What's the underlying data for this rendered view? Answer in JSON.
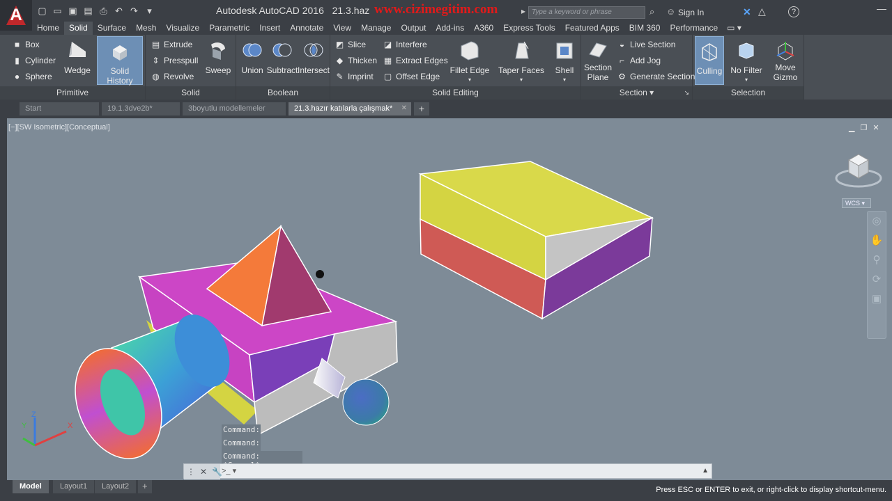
{
  "titlebar": {
    "title": "Autodesk AutoCAD 2016",
    "doc_prefix": "21.3.haz",
    "watermark": "www.cizimegitim.com",
    "search_placeholder": "Type a keyword or phrase",
    "signin": "Sign In",
    "help": "?"
  },
  "qat_icons": [
    "new-file-icon",
    "open-folder-icon",
    "save-icon",
    "save-as-icon",
    "print-icon",
    "undo-icon",
    "redo-icon",
    "dropdown-icon"
  ],
  "ribbon_tabs": [
    "Home",
    "Solid",
    "Surface",
    "Mesh",
    "Visualize",
    "Parametric",
    "Insert",
    "Annotate",
    "View",
    "Manage",
    "Output",
    "Add-ins",
    "A360",
    "Express Tools",
    "Featured Apps",
    "BIM 360",
    "Performance"
  ],
  "active_tab": "Solid",
  "panels": {
    "primitive": {
      "title": "Primitive",
      "small": [
        "Box",
        "Cylinder",
        "Sphere"
      ],
      "wedge": "Wedge",
      "solid_history": "Solid History"
    },
    "solid": {
      "title": "Solid",
      "small": [
        "Extrude",
        "Presspull",
        "Revolve"
      ],
      "sweep": "Sweep"
    },
    "boolean": {
      "title": "Boolean",
      "union": "Union",
      "subtract": "Subtract",
      "intersect": "Intersect"
    },
    "solid_editing": {
      "title": "Solid Editing",
      "col1": [
        "Slice",
        "Thicken",
        "Imprint"
      ],
      "col2": [
        "Interfere",
        "Extract Edges",
        "Offset Edge"
      ],
      "fillet": "Fillet Edge",
      "taper": "Taper Faces",
      "shell": "Shell"
    },
    "section": {
      "title": "Section",
      "plane_line1": "Section",
      "plane_line2": "Plane",
      "small": [
        "Live Section",
        "Add Jog",
        "Generate Section"
      ]
    },
    "selection": {
      "title": "Selection",
      "culling": "Culling",
      "nofilter": "No Filter",
      "gizmo_line1": "Move",
      "gizmo_line2": "Gizmo"
    }
  },
  "doc_tabs": [
    "Start",
    "19.1.3dve2b*",
    "3boyutlu modellemeler",
    "21.3.hazır katılarla çalışmak*"
  ],
  "active_doc_tab": "21.3.hazır katılarla çalışmak*",
  "viewport": {
    "label": "[−][SW Isometric][Conceptual]",
    "wcs": "WCS",
    "ucs_x": "X",
    "ucs_y": "Y",
    "ucs_z": "Z"
  },
  "command_history": [
    "Command:",
    "Command:",
    "Command: *Cancel*"
  ],
  "layout_tabs": [
    "Model",
    "Layout1",
    "Layout2"
  ],
  "active_layout": "Model",
  "status_message": "Press ESC or ENTER to exit, or right-click to display shortcut-menu.",
  "colors": {
    "accent": "#6d8fb5",
    "app_red": "#c0282b",
    "watermark_red": "#e11a1a",
    "viewport_bg": "#7e8b97"
  }
}
